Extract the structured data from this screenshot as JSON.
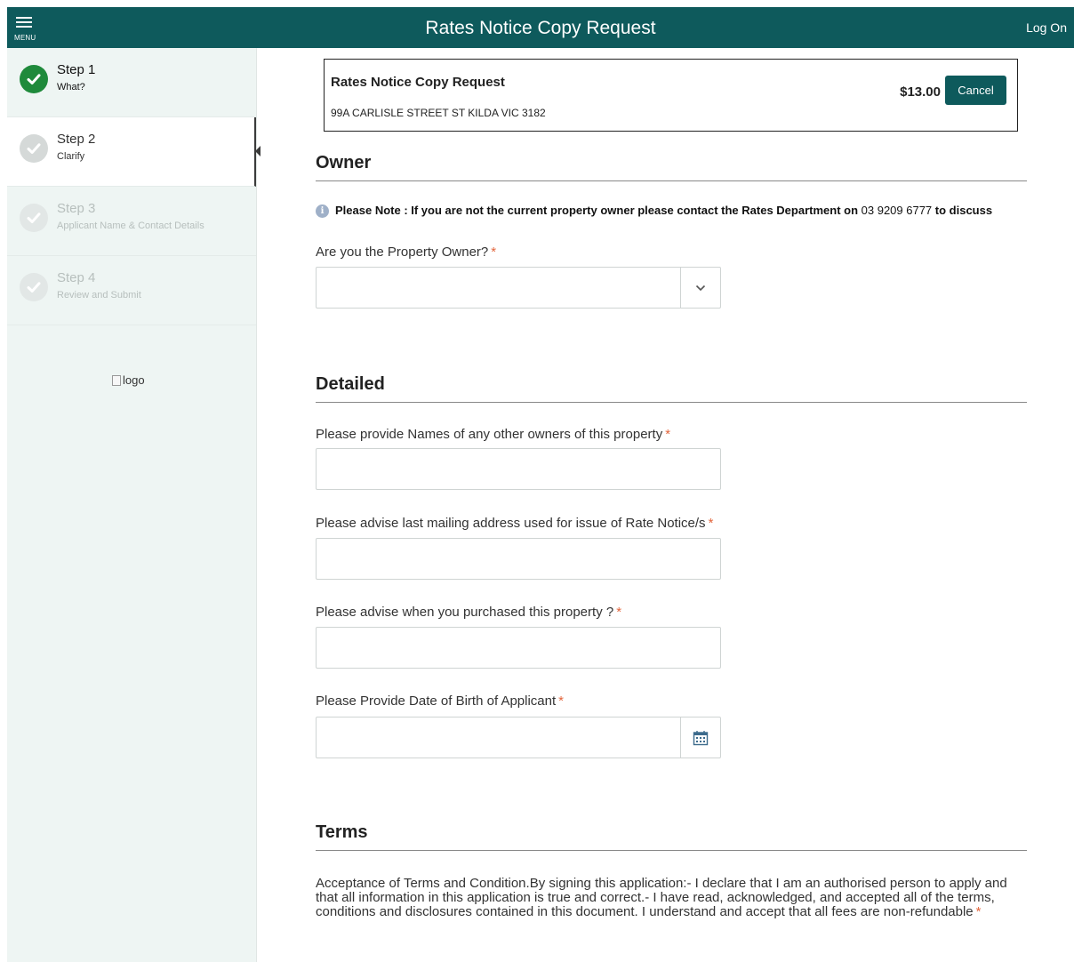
{
  "header": {
    "menu_label": "MENU",
    "title": "Rates Notice Copy Request",
    "logon_label": "Log On"
  },
  "sidebar": {
    "steps": [
      {
        "title": "Step 1",
        "subtitle": "What?",
        "state": "done"
      },
      {
        "title": "Step 2",
        "subtitle": "Clarify",
        "state": "current"
      },
      {
        "title": "Step 3",
        "subtitle": "Applicant Name & Contact Details",
        "state": "todo"
      },
      {
        "title": "Step 4",
        "subtitle": "Review and Submit",
        "state": "todo"
      }
    ],
    "logo_alt": "logo"
  },
  "summary": {
    "title": "Rates Notice Copy Request",
    "address": "99A CARLISLE STREET ST KILDA VIC 3182",
    "price": "$13.00",
    "cancel_label": "Cancel"
  },
  "owner_section": {
    "title": "Owner",
    "note_prefix": "Please Note :  If you are not the current property owner please contact the Rates Department on ",
    "note_phone": "03 9209 6777",
    "note_suffix": " to discuss",
    "property_owner_label": "Are you the Property Owner?",
    "property_owner_value": ""
  },
  "detailed_section": {
    "title": "Detailed",
    "other_owners_label": "Please provide Names of any other owners of this property",
    "mailing_address_label": "Please advise last mailing address used for issue of Rate Notice/s",
    "purchase_date_label": "Please advise when you purchased this property ?",
    "dob_label": "Please Provide Date of Birth of Applicant"
  },
  "terms_section": {
    "title": "Terms",
    "text": "Acceptance of Terms and Condition.By signing this application:- I declare that I am an authorised person to apply and that all information in this application is true and correct.- I have read, acknowledged, and accepted all of the terms, conditions and disclosures contained in this document. I understand and accept that all fees are non-refundable"
  },
  "required_marker": "*",
  "colors": {
    "brand": "#0e5a5c",
    "step_done": "#1f8a3b",
    "required": "#e3653c",
    "sidebar_bg": "#eef5f3"
  }
}
